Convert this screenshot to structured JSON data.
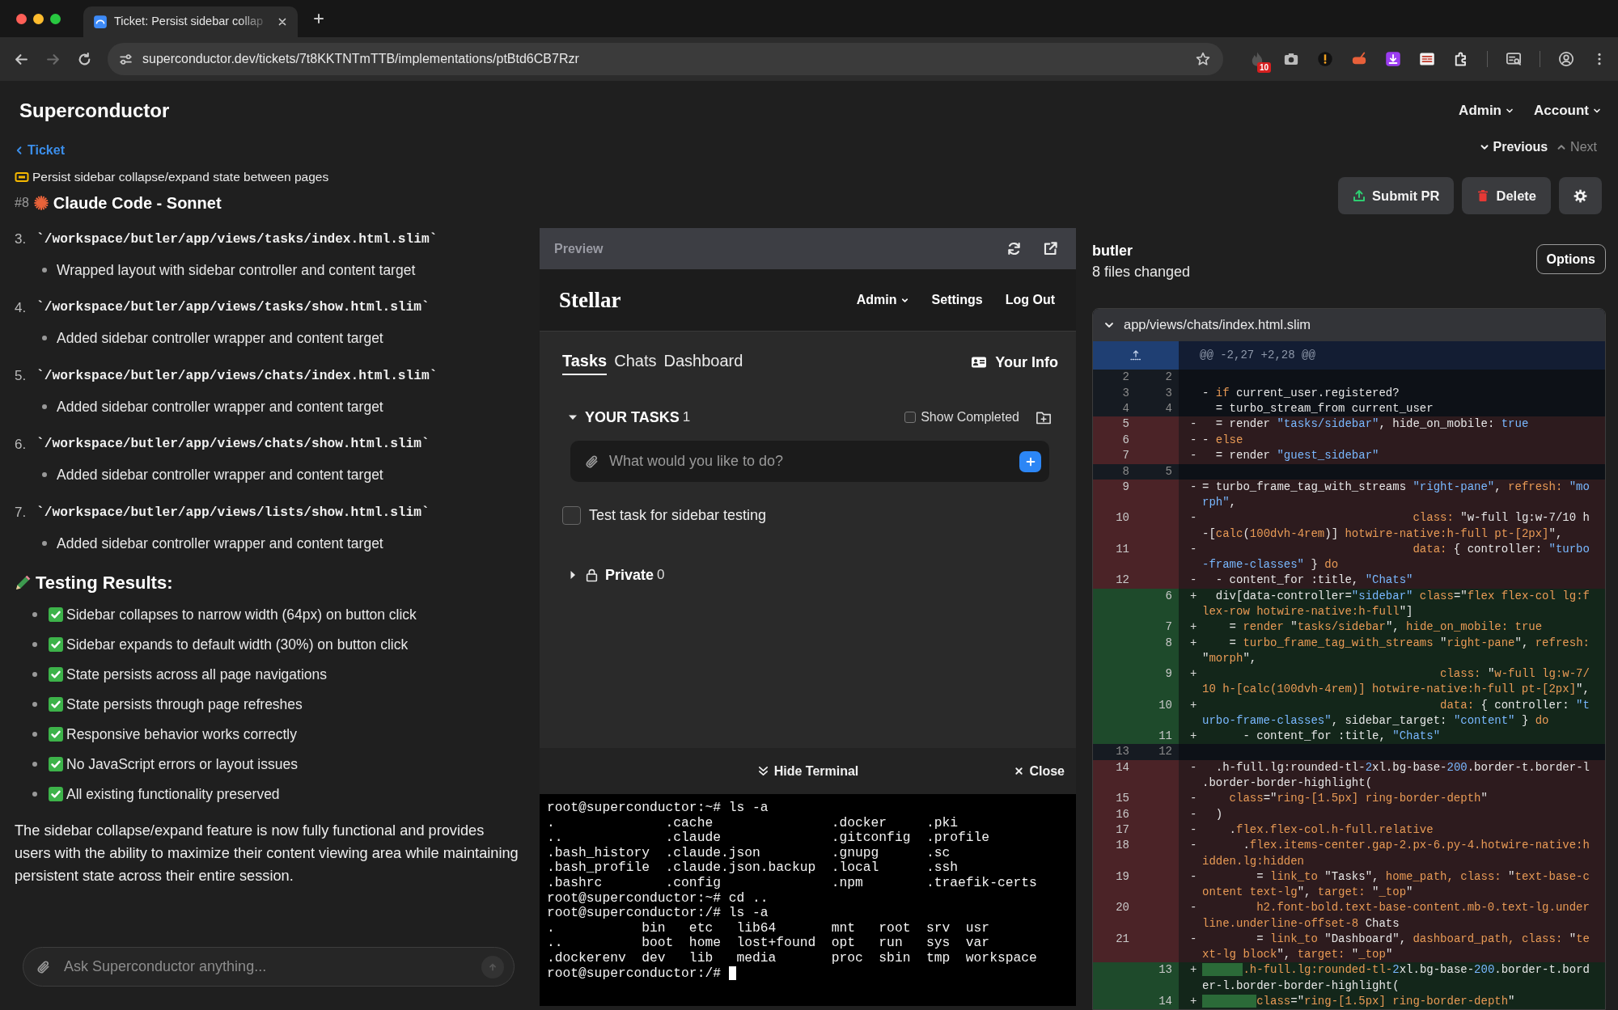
{
  "browser": {
    "tab_title": "Ticket: Persist sidebar collap",
    "url": "superconductor.dev/tickets/7t8KKTNTmTTB/implementations/ptBtd6CB7Rzr",
    "extension_badge": "10",
    "nav_buttons": [
      {
        "kind": "back",
        "disabled": false
      },
      {
        "kind": "forward",
        "disabled": true
      },
      {
        "kind": "reload",
        "disabled": false
      }
    ]
  },
  "app": {
    "brand": "Superconductor",
    "menus": [
      "Admin",
      "Account"
    ]
  },
  "ticket": {
    "back_link": "Ticket",
    "title": "Persist sidebar collapse/expand state between pages",
    "number": "#8",
    "agent": "Claude Code - Sonnet",
    "nav": [
      {
        "kind": "previous",
        "label": "Previous",
        "disabled": false
      },
      {
        "kind": "next",
        "label": "Next",
        "disabled": true
      }
    ],
    "actions": [
      {
        "kind": "submit",
        "label": "Submit PR"
      },
      {
        "kind": "delete",
        "label": "Delete"
      },
      {
        "kind": "settings"
      }
    ]
  },
  "summary": {
    "files": [
      {
        "number": "3.",
        "path": "`/workspace/butler/app/views/tasks/index.html.slim`",
        "notes": [
          "Wrapped layout with sidebar controller and content target"
        ]
      },
      {
        "number": "4.",
        "path": "`/workspace/butler/app/views/tasks/show.html.slim`",
        "notes": [
          "Added sidebar controller wrapper and content target"
        ]
      },
      {
        "number": "5.",
        "path": "`/workspace/butler/app/views/chats/index.html.slim`",
        "notes": [
          "Added sidebar controller wrapper and content target"
        ]
      },
      {
        "number": "6.",
        "path": "`/workspace/butler/app/views/chats/show.html.slim`",
        "notes": [
          "Added sidebar controller wrapper and content target"
        ]
      },
      {
        "number": "7.",
        "path": "`/workspace/butler/app/views/lists/show.html.slim`",
        "notes": [
          "Added sidebar controller wrapper and content target"
        ]
      }
    ],
    "heading": "Testing Results:",
    "results": [
      {
        "text": "Sidebar collapses to narrow width (64px) on button click",
        "checked": true
      },
      {
        "text": "Sidebar expands to default width (30%) on button click",
        "checked": true
      },
      {
        "text": "State persists across all page navigations",
        "checked": true
      },
      {
        "text": "State persists through page refreshes",
        "checked": true
      },
      {
        "text": "Responsive behavior works correctly",
        "checked": true
      },
      {
        "text": "No JavaScript errors or layout issues",
        "checked": true
      },
      {
        "text": "All existing functionality preserved",
        "checked": true
      }
    ],
    "paragraph": "The sidebar collapse/expand feature is now fully functional and provides users with the ability to maximize their content viewing area while maintaining persistent state across their entire session.",
    "chat": {
      "placeholder": "Ask Superconductor anything...",
      "send_disabled": true
    }
  },
  "preview": {
    "title": "Preview",
    "brand": "Stellar",
    "menu": [
      {
        "label": "Admin",
        "dropdown": true
      },
      {
        "label": "Settings",
        "dropdown": false
      },
      {
        "label": "Log Out",
        "dropdown": false
      }
    ],
    "tabs": [
      {
        "label": "Tasks",
        "selected": true
      },
      {
        "label": "Chats",
        "selected": false
      },
      {
        "label": "Dashboard",
        "selected": false
      }
    ],
    "your_info": "Your Info",
    "sections": [
      {
        "kind": "tasks",
        "title": "YOUR TASKS",
        "count": "1",
        "expanded": true,
        "show_completed": {
          "label": "Show Completed",
          "checked": false
        },
        "placeholder": "What would you like to do?",
        "tasks": [
          {
            "text": "Test task for sidebar testing",
            "checked": false
          }
        ]
      },
      {
        "kind": "private",
        "title": "Private",
        "count": "0",
        "expanded": false
      }
    ]
  },
  "terminal": {
    "hide_label": "Hide Terminal",
    "close_label": "Close",
    "lines": [
      "root@superconductor:~# ls -a",
      ".              .cache               .docker     .pki",
      "..             .claude              .gitconfig  .profile",
      ".bash_history  .claude.json         .gnupg      .sc",
      ".bash_profile  .claude.json.backup  .local      .ssh",
      ".bashrc        .config              .npm        .traefik-certs",
      "root@superconductor:~# cd ..",
      "root@superconductor:/# ls -a",
      ".           bin   etc   lib64       mnt   root  srv  usr",
      "..          boot  home  lost+found  opt   run   sys  var",
      ".dockerenv  dev   lib   media       proc  sbin  tmp  workspace",
      "root@superconductor:/# "
    ]
  },
  "diff": {
    "repo": "butler",
    "summary": "8 files changed",
    "options": "Options",
    "file": {
      "path": "app/views/chats/index.html.slim",
      "expanded": true,
      "hunk": "@@ -2,27 +2,28 @@",
      "lines": [
        {
          "kind": "context",
          "old": "2",
          "new": "2"
        },
        {
          "kind": "context",
          "old": "3",
          "new": "3",
          "code": [
            {
              "kind": "plain",
              "text": "- "
            },
            {
              "kind": "keyword",
              "text": "if"
            },
            {
              "kind": "plain",
              "text": " current_user.registered?"
            }
          ]
        },
        {
          "kind": "context",
          "old": "4",
          "new": "4",
          "code": [
            {
              "kind": "plain",
              "text": "  = turbo_stream_from current_user"
            }
          ]
        },
        {
          "kind": "deletion",
          "old": "5",
          "sign": "-",
          "code": [
            {
              "kind": "plain",
              "text": "  = render "
            },
            {
              "kind": "string",
              "text": "\"tasks/sidebar\""
            },
            {
              "kind": "plain",
              "text": ", hide_on_mobile: "
            },
            {
              "kind": "string",
              "text": "true"
            }
          ]
        },
        {
          "kind": "deletion",
          "old": "6",
          "sign": "-",
          "code": [
            {
              "kind": "plain",
              "text": "- "
            },
            {
              "kind": "keyword",
              "text": "else"
            }
          ]
        },
        {
          "kind": "deletion",
          "old": "7",
          "sign": "-",
          "code": [
            {
              "kind": "plain",
              "text": "  = render "
            },
            {
              "kind": "string",
              "text": "\"guest_sidebar\""
            }
          ]
        },
        {
          "kind": "context",
          "old": "8",
          "new": "5"
        },
        {
          "kind": "deletion",
          "old": "9",
          "sign": "-",
          "code": [
            {
              "kind": "plain",
              "text": "= turbo_frame_tag_with_streams "
            },
            {
              "kind": "string",
              "text": "\"right-pane\""
            },
            {
              "kind": "plain",
              "text": ", "
            },
            {
              "kind": "keyword",
              "text": "refresh:"
            },
            {
              "kind": "string",
              "text": " \"morph\""
            },
            {
              "kind": "plain",
              "text": ","
            }
          ]
        },
        {
          "kind": "deletion",
          "old": "10",
          "sign": "-",
          "code": [
            {
              "kind": "keyword",
              "text": "                               class:"
            },
            {
              "kind": "plain",
              "text": " \"w-full lg:w-7/10 h-["
            },
            {
              "kind": "keyword",
              "text": "calc"
            },
            {
              "kind": "plain",
              "text": "("
            },
            {
              "kind": "keyword",
              "text": "100dvh-4rem"
            },
            {
              "kind": "plain",
              "text": ")] "
            },
            {
              "kind": "keyword",
              "text": "hotwire-native:h-full pt-[2px]"
            },
            {
              "kind": "plain",
              "text": "\","
            }
          ]
        },
        {
          "kind": "deletion",
          "old": "11",
          "sign": "-",
          "code": [
            {
              "kind": "keyword",
              "text": "                               data:"
            },
            {
              "kind": "plain",
              "text": " { controller: "
            },
            {
              "kind": "string",
              "text": "\"turbo-frame-classes\""
            },
            {
              "kind": "plain",
              "text": " } "
            },
            {
              "kind": "keyword",
              "text": "do"
            }
          ]
        },
        {
          "kind": "deletion",
          "old": "12",
          "sign": "-",
          "code": [
            {
              "kind": "plain",
              "text": "  - content_for :title, "
            },
            {
              "kind": "string",
              "text": "\"Chats\""
            }
          ]
        },
        {
          "kind": "addition",
          "new": "6",
          "sign": "+",
          "code": [
            {
              "kind": "plain",
              "text": "  div[data-controller="
            },
            {
              "kind": "string",
              "text": "\"sidebar\""
            },
            {
              "kind": "keyword",
              "text": " class"
            },
            {
              "kind": "plain",
              "text": "=\""
            },
            {
              "kind": "keyword",
              "text": "flex flex-col lg:flex-row hotwire-native:h-full"
            },
            {
              "kind": "plain",
              "text": "\"]"
            }
          ]
        },
        {
          "kind": "addition",
          "new": "7",
          "sign": "+",
          "code": [
            {
              "kind": "plain",
              "text": "    = "
            },
            {
              "kind": "keyword",
              "text": "render"
            },
            {
              "kind": "plain",
              "text": " \""
            },
            {
              "kind": "keyword",
              "text": "tasks/sidebar"
            },
            {
              "kind": "plain",
              "text": "\", "
            },
            {
              "kind": "keyword",
              "text": "hide_on_mobile: true"
            }
          ]
        },
        {
          "kind": "addition",
          "new": "8",
          "sign": "+",
          "code": [
            {
              "kind": "plain",
              "text": "    = "
            },
            {
              "kind": "keyword",
              "text": "turbo_frame_tag_with_streams"
            },
            {
              "kind": "plain",
              "text": " \""
            },
            {
              "kind": "keyword",
              "text": "right-pane"
            },
            {
              "kind": "plain",
              "text": "\", "
            },
            {
              "kind": "keyword",
              "text": "refresh:"
            },
            {
              "kind": "plain",
              "text": " \""
            },
            {
              "kind": "keyword",
              "text": "morph"
            },
            {
              "kind": "plain",
              "text": "\","
            }
          ]
        },
        {
          "kind": "addition",
          "new": "9",
          "sign": "+",
          "code": [
            {
              "kind": "keyword",
              "text": "                                   class:"
            },
            {
              "kind": "plain",
              "text": " \""
            },
            {
              "kind": "keyword",
              "text": "w-full lg:w-7/10 h-[calc(100dvh-4rem)] hotwire-native:h-full pt-[2px]"
            },
            {
              "kind": "plain",
              "text": "\","
            }
          ]
        },
        {
          "kind": "addition",
          "new": "10",
          "sign": "+",
          "code": [
            {
              "kind": "keyword",
              "text": "                                   data:"
            },
            {
              "kind": "plain",
              "text": " { controller: "
            },
            {
              "kind": "string",
              "text": "\"turbo-frame-classes\""
            },
            {
              "kind": "plain",
              "text": ", sidebar_target: "
            },
            {
              "kind": "string",
              "text": "\"content\""
            },
            {
              "kind": "plain",
              "text": " } "
            },
            {
              "kind": "keyword",
              "text": "do"
            }
          ]
        },
        {
          "kind": "addition",
          "new": "11",
          "sign": "+",
          "code": [
            {
              "kind": "plain",
              "text": "      - content_for :title, "
            },
            {
              "kind": "string",
              "text": "\"Chats\""
            }
          ]
        },
        {
          "kind": "context",
          "old": "13",
          "new": "12"
        },
        {
          "kind": "deletion",
          "old": "14",
          "sign": "-",
          "code": [
            {
              "kind": "plain",
              "text": "  .h-full.lg:rounded-tl-"
            },
            {
              "kind": "string",
              "text": "2"
            },
            {
              "kind": "plain",
              "text": "xl.bg-base-"
            },
            {
              "kind": "string",
              "text": "200"
            },
            {
              "kind": "plain",
              "text": ".border-t.border-l.border-border-highlight("
            }
          ]
        },
        {
          "kind": "deletion",
          "old": "15",
          "sign": "-",
          "code": [
            {
              "kind": "keyword",
              "text": "    class"
            },
            {
              "kind": "plain",
              "text": "=\""
            },
            {
              "kind": "keyword",
              "text": "ring-[1.5px] ring-border-depth"
            },
            {
              "kind": "plain",
              "text": "\""
            }
          ]
        },
        {
          "kind": "deletion",
          "old": "16",
          "sign": "-",
          "code": [
            {
              "kind": "plain",
              "text": "  )"
            }
          ]
        },
        {
          "kind": "deletion",
          "old": "17",
          "sign": "-",
          "code": [
            {
              "kind": "plain",
              "text": "    ."
            },
            {
              "kind": "keyword",
              "text": "flex.flex-col.h-full.relative"
            }
          ]
        },
        {
          "kind": "deletion",
          "old": "18",
          "sign": "-",
          "code": [
            {
              "kind": "plain",
              "text": "      ."
            },
            {
              "kind": "keyword",
              "text": "flex.items-center.gap-2.px-6.py-4.hotwire-native:hidden.lg:hidden"
            }
          ]
        },
        {
          "kind": "deletion",
          "old": "19",
          "sign": "-",
          "code": [
            {
              "kind": "plain",
              "text": "        = "
            },
            {
              "kind": "keyword",
              "text": "link_to"
            },
            {
              "kind": "plain",
              "text": " \"Tasks\", "
            },
            {
              "kind": "keyword",
              "text": "home_path, class:"
            },
            {
              "kind": "plain",
              "text": " \""
            },
            {
              "kind": "keyword",
              "text": "text-base-content text-lg"
            },
            {
              "kind": "plain",
              "text": "\", "
            },
            {
              "kind": "keyword",
              "text": "target:"
            },
            {
              "kind": "plain",
              "text": " \""
            },
            {
              "kind": "keyword",
              "text": "_top"
            },
            {
              "kind": "plain",
              "text": "\""
            }
          ]
        },
        {
          "kind": "deletion",
          "old": "20",
          "sign": "-",
          "code": [
            {
              "kind": "keyword",
              "text": "        h2.font-bold.text-base-content.mb-0.text-lg.underline.underline-offset-8"
            },
            {
              "kind": "plain",
              "text": " Chats"
            }
          ]
        },
        {
          "kind": "deletion",
          "old": "21",
          "sign": "-",
          "code": [
            {
              "kind": "plain",
              "text": "        = "
            },
            {
              "kind": "keyword",
              "text": "link_to"
            },
            {
              "kind": "plain",
              "text": " \"Dashboard\", "
            },
            {
              "kind": "keyword",
              "text": "dashboard_path, class:"
            },
            {
              "kind": "plain",
              "text": " \""
            },
            {
              "kind": "keyword",
              "text": "text-lg block"
            },
            {
              "kind": "plain",
              "text": "\", "
            },
            {
              "kind": "keyword",
              "text": "target:"
            },
            {
              "kind": "plain",
              "text": " \""
            },
            {
              "kind": "keyword",
              "text": "_top"
            },
            {
              "kind": "plain",
              "text": "\""
            }
          ]
        },
        {
          "kind": "addition",
          "new": "13",
          "sign": "+",
          "code": [
            {
              "kind": "added-whitespace",
              "text": "      .h-full.lg:rounded-tl-"
            },
            {
              "kind": "string",
              "text": "2"
            },
            {
              "kind": "plain",
              "text": "xl.bg-base-"
            },
            {
              "kind": "string",
              "text": "200"
            },
            {
              "kind": "plain",
              "text": ".border-t.border-l.border-border-highlight("
            }
          ]
        },
        {
          "kind": "addition",
          "new": "14",
          "sign": "+",
          "code": [
            {
              "kind": "added-whitespace",
              "text": "        class"
            },
            {
              "kind": "plain",
              "text": "=\""
            },
            {
              "kind": "keyword",
              "text": "ring-[1.5px] ring-border-depth"
            },
            {
              "kind": "plain",
              "text": "\""
            }
          ]
        }
      ]
    }
  }
}
